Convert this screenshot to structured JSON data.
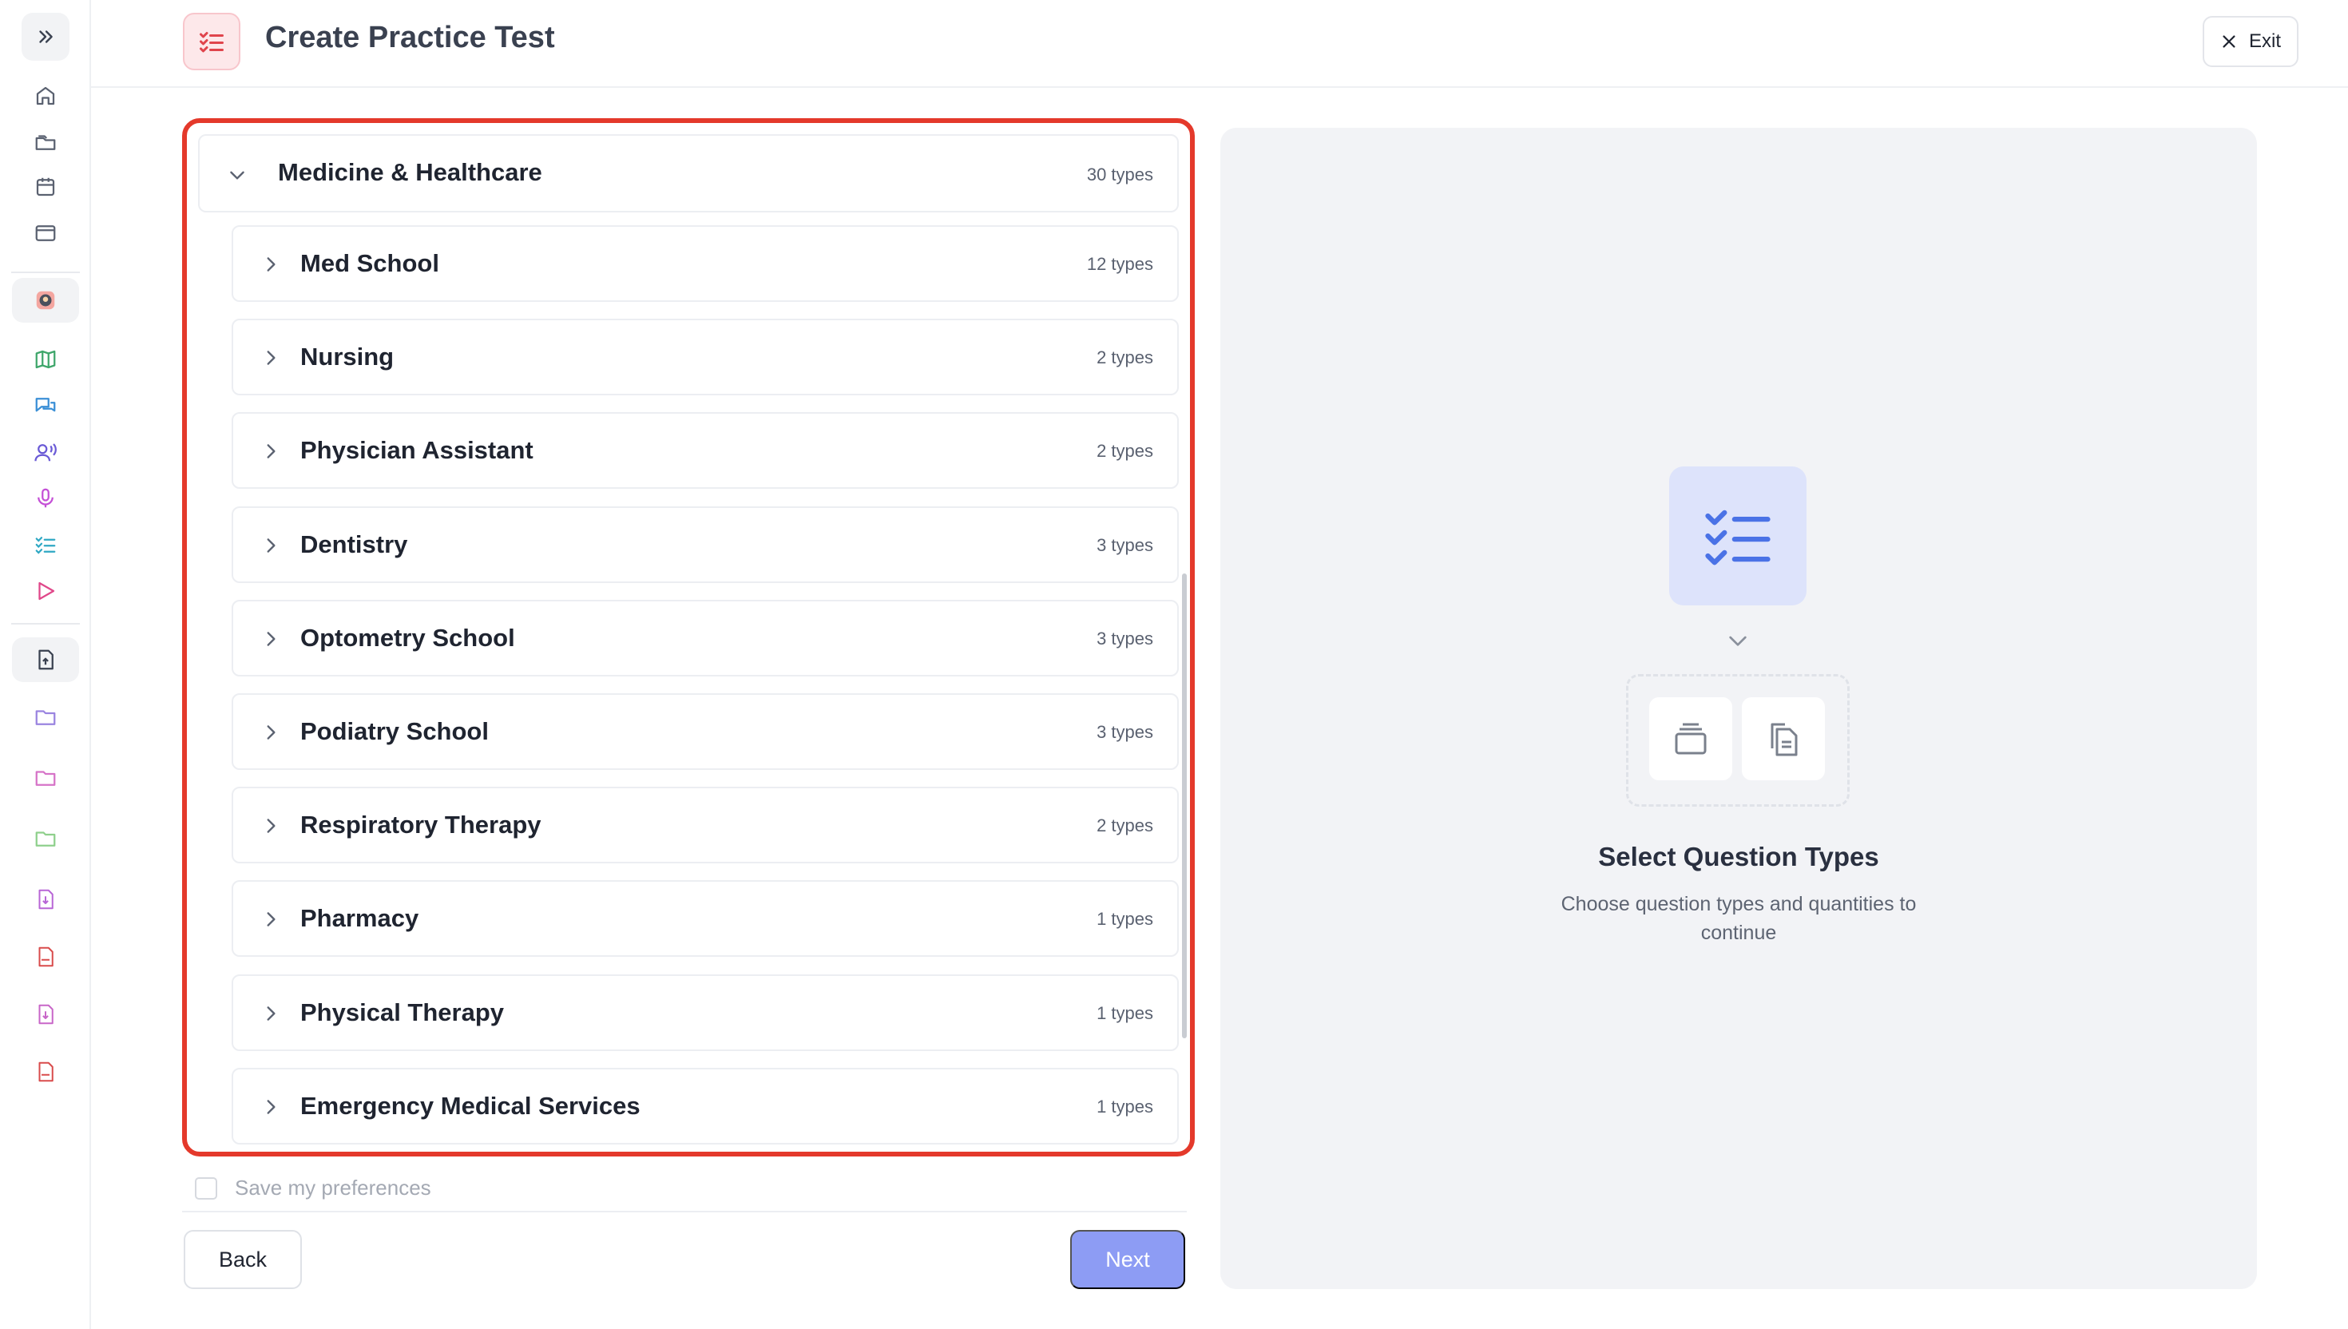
{
  "header": {
    "title": "Create Practice Test",
    "exit_label": "Exit"
  },
  "sidebar": {
    "icons": [
      "expand-icon",
      "home-icon",
      "folders-icon",
      "calendar-icon",
      "browser-window-icon",
      "avatar-icon",
      "map-icon",
      "chat-icon",
      "voice-icon",
      "microphone-icon",
      "checklist-icon",
      "play-icon",
      "file-upload-icon",
      "folder-icon",
      "folder-pink-icon",
      "folder-green-icon",
      "file-download-icon",
      "pdf-icon",
      "file-download-pink-icon",
      "pdf-red-icon"
    ]
  },
  "category": {
    "name": "Medicine & Healthcare",
    "count": "30 types",
    "subcategories": [
      {
        "name": "Med School",
        "count": "12 types"
      },
      {
        "name": "Nursing",
        "count": "2 types"
      },
      {
        "name": "Physician Assistant",
        "count": "2 types"
      },
      {
        "name": "Dentistry",
        "count": "3 types"
      },
      {
        "name": "Optometry School",
        "count": "3 types"
      },
      {
        "name": "Podiatry School",
        "count": "3 types"
      },
      {
        "name": "Respiratory Therapy",
        "count": "2 types"
      },
      {
        "name": "Pharmacy",
        "count": "1 types"
      },
      {
        "name": "Physical Therapy",
        "count": "1 types"
      },
      {
        "name": "Emergency Medical Services",
        "count": "1 types"
      }
    ]
  },
  "footer": {
    "save_pref_label": "Save my preferences",
    "back_label": "Back",
    "next_label": "Next"
  },
  "empty_state": {
    "title": "Select Question Types",
    "description": "Choose question types and quantities to continue"
  },
  "colors": {
    "highlight_border": "#e4392b",
    "next_button": "#8d9cf4",
    "accent_blue": "#4a72e6"
  }
}
